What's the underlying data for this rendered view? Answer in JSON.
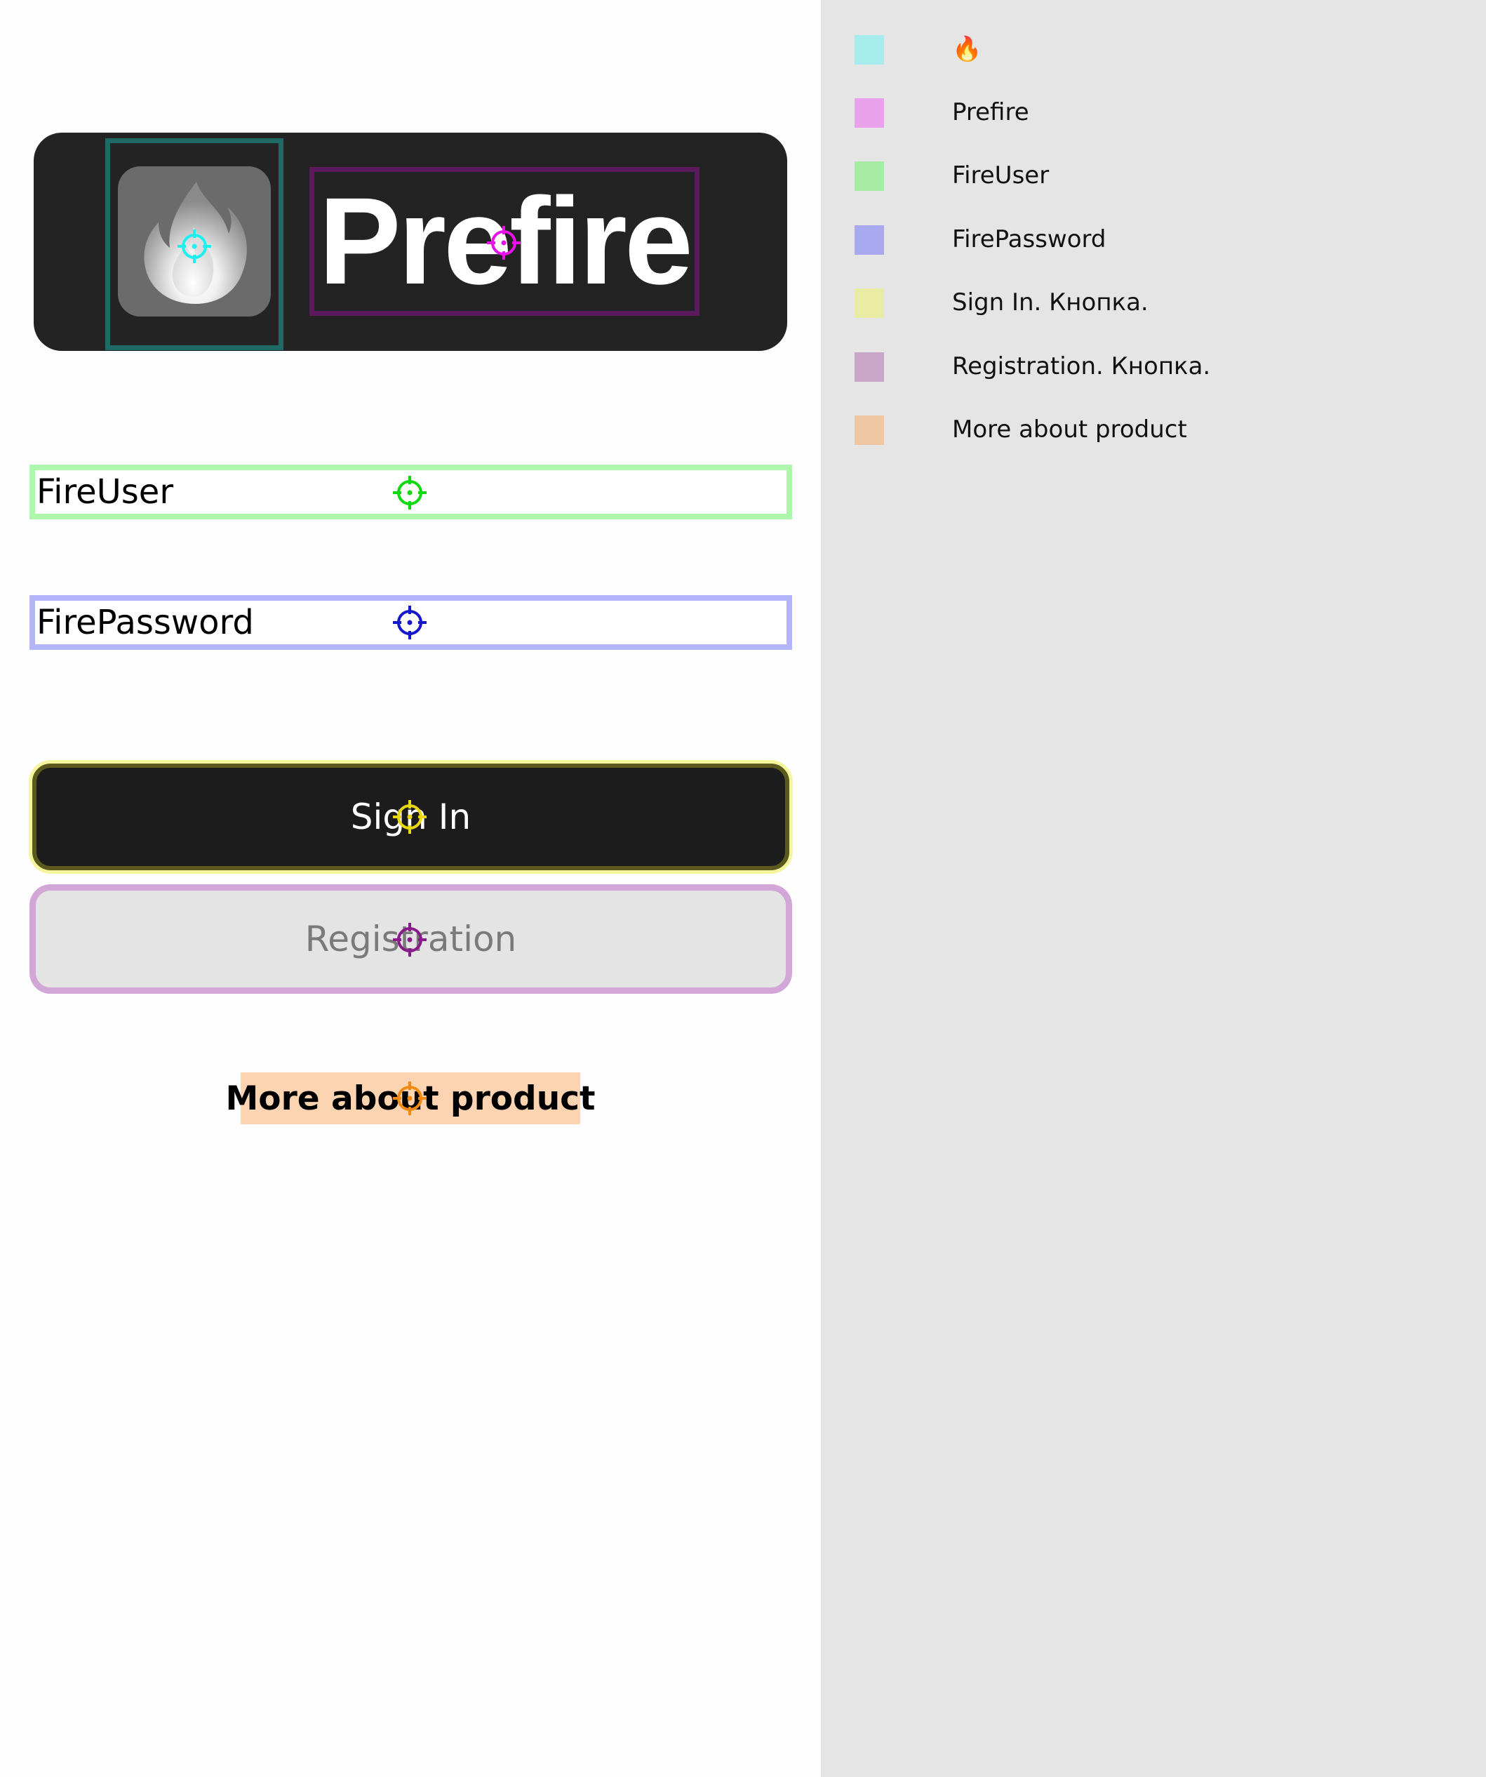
{
  "app": {
    "title": "Prefire",
    "logo_icon": "fire-icon",
    "username": {
      "placeholder": "FireUser",
      "value": ""
    },
    "password": {
      "placeholder": "FirePassword",
      "value": ""
    },
    "sign_in_label": "Sign In",
    "registration_label": "Registration",
    "more_label": "More about product"
  },
  "legend": {
    "items": [
      {
        "label": "🔥",
        "color": "#a6ecec"
      },
      {
        "label": "Prefire",
        "color": "#eaa1ec"
      },
      {
        "label": "FireUser",
        "color": "#a6eba4"
      },
      {
        "label": "FirePassword",
        "color": "#a8a9ee"
      },
      {
        "label": "Sign In. Кнопка.",
        "color": "#eaeca4"
      },
      {
        "label": "Registration. Кнопка.",
        "color": "#c9a5ca"
      },
      {
        "label": "More about product",
        "color": "#eec7a2"
      }
    ]
  },
  "markers": {
    "logo": "#1ef0f0",
    "title": "#e812e8",
    "username": "#12d812",
    "password": "#1616cc",
    "sign_in": "#e8d812",
    "registration": "#8a1a8a",
    "more": "#f08a12"
  }
}
